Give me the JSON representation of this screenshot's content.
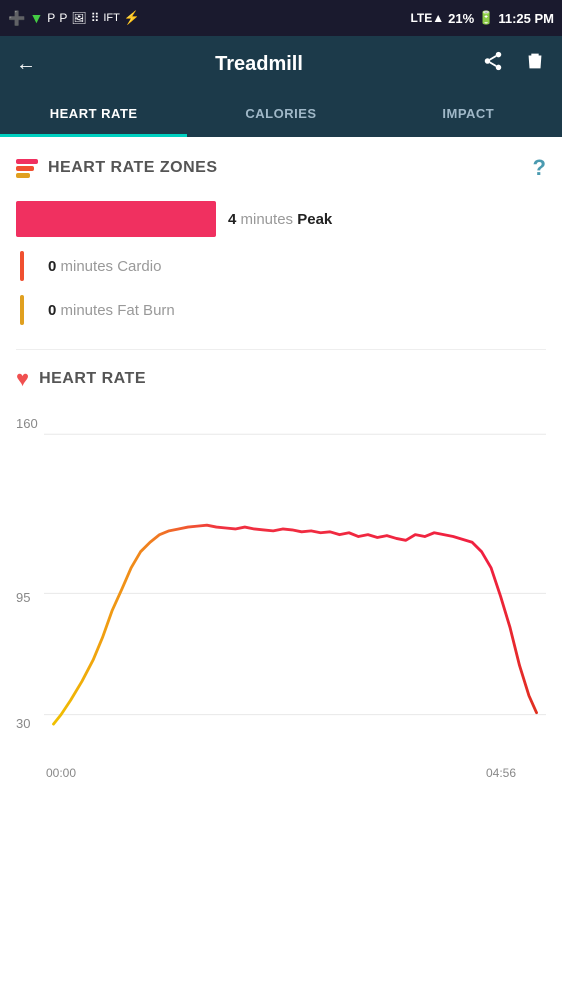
{
  "statusBar": {
    "time": "11:25 PM",
    "battery": "21%"
  },
  "header": {
    "back_label": "←",
    "title": "Treadmill",
    "share_icon": "share",
    "delete_icon": "delete"
  },
  "tabs": [
    {
      "id": "heart-rate",
      "label": "HEART RATE",
      "active": true
    },
    {
      "id": "calories",
      "label": "CALORIES",
      "active": false
    },
    {
      "id": "impact",
      "label": "IMPACT",
      "active": false
    }
  ],
  "heartRateZones": {
    "section_title": "HEART RATE ZONES",
    "help_label": "?",
    "zones": [
      {
        "id": "peak",
        "minutes": 4,
        "label": "minutes",
        "name": "Peak",
        "type": "bar"
      },
      {
        "id": "cardio",
        "minutes": 0,
        "label": "minutes",
        "name": "Cardio",
        "type": "line"
      },
      {
        "id": "fatburn",
        "minutes": 0,
        "label": "minutes",
        "name": "Fat Burn",
        "type": "line"
      }
    ]
  },
  "heartRateChart": {
    "section_title": "HEART RATE",
    "y_labels": [
      "160",
      "95",
      "30"
    ],
    "x_labels": [
      "00:00",
      "04:56"
    ]
  }
}
